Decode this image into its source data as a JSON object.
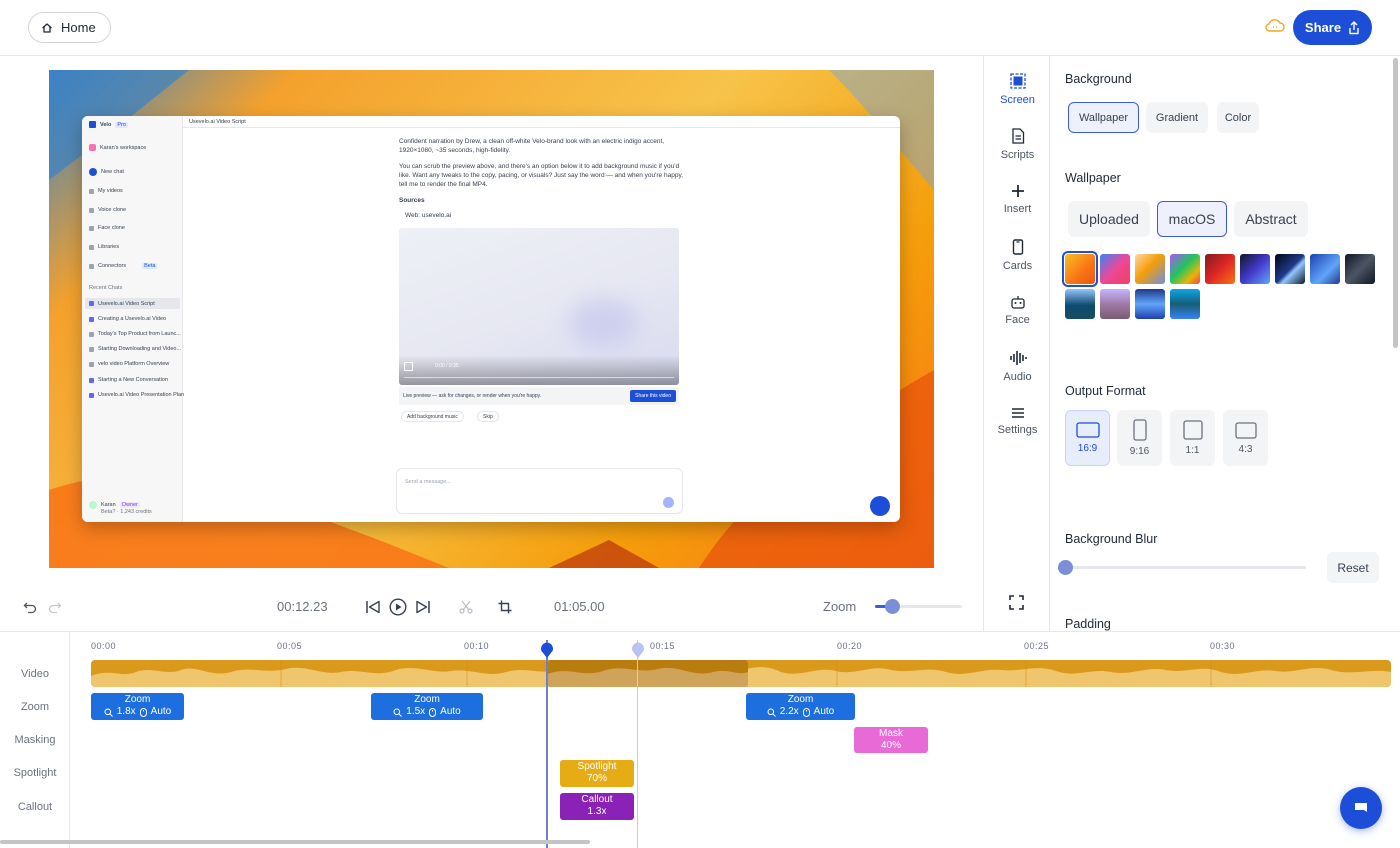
{
  "topbar": {
    "home_label": "Home",
    "share_label": "Share"
  },
  "preview": {
    "app": {
      "brand": "Velo",
      "brand_badge": "Pro",
      "workspace": "Karan's workspace",
      "nav": [
        "New chat",
        "My videos",
        "Voice clone",
        "Face clone",
        "Libraries",
        "Connectors"
      ],
      "connectors_badge": "Beta",
      "recent_title": "Recent Chats",
      "recent": [
        "Usevelo.ai Video Script",
        "Creating a Usevelo.ai Video",
        "Today's Top Product from Launc...",
        "Starting Downloading and Video...",
        "velo video Platform Overview",
        "Starting a New Conversation",
        "Usevelo.ai Video Presentation Plan"
      ],
      "user_name": "Karan",
      "user_badge": "Owner",
      "user_credits": "Beta? · 1,243 credits",
      "chat_title": "Usevelo.ai Video Script",
      "msg1": "Confident narration by Drew, a clean off-white Velo-brand look with an electric indigo accent, 1920×1080, ~35 seconds, high-fidelity.",
      "msg2": "You can scrub the preview above, and there's an option below it to add background music if you'd like. Want any tweaks to the copy, pacing, or visuals? Just say the word — and when you're happy, tell me to render the final MP4.",
      "sources_title": "Sources",
      "source_item": "Web: usevelo.ai",
      "video_time": "0:00 / 0:35",
      "live_text": "Live preview — ask for changes, or render when you're happy.",
      "share_video": "Share this video",
      "chip_music": "Add background music",
      "chip_skip": "Skip",
      "input_placeholder": "Send a message..."
    }
  },
  "transport": {
    "current_time": "00:12.23",
    "total_time": "01:05.00",
    "zoom_label": "Zoom",
    "zoom_level": 0.2
  },
  "rail": [
    {
      "label": "Screen",
      "icon": "screen-icon",
      "active": true
    },
    {
      "label": "Scripts",
      "icon": "document-icon"
    },
    {
      "label": "Insert",
      "icon": "plus-icon"
    },
    {
      "label": "Cards",
      "icon": "phone-card-icon"
    },
    {
      "label": "Face",
      "icon": "robot-face-icon"
    },
    {
      "label": "Audio",
      "icon": "waveform-icon"
    },
    {
      "label": "Settings",
      "icon": "menu-icon"
    }
  ],
  "panel": {
    "background_title": "Background",
    "background_tabs": [
      "Wallpaper",
      "Gradient",
      "Color"
    ],
    "background_selected": "Wallpaper",
    "wallpaper_title": "Wallpaper",
    "wallpaper_tabs": [
      "Uploaded",
      "macOS",
      "Abstract"
    ],
    "wallpaper_selected": "macOS",
    "wallpaper_selected_index": 0,
    "output_title": "Output Format",
    "formats": [
      "16:9",
      "9:16",
      "1:1",
      "4:3"
    ],
    "format_selected": "16:9",
    "blur_title": "Background Blur",
    "blur_value": 0,
    "reset_label": "Reset",
    "padding_title": "Padding"
  },
  "timeline": {
    "tracks": [
      "Video",
      "Zoom",
      "Masking",
      "Spotlight",
      "Callout"
    ],
    "ticks": [
      "00:00",
      "00:05",
      "00:10",
      "00:15",
      "00:20",
      "00:25",
      "00:30"
    ],
    "zooms": [
      {
        "title": "Zoom",
        "factor": "1.8x",
        "mode": "Auto"
      },
      {
        "title": "Zoom",
        "factor": "1.5x",
        "mode": "Auto"
      },
      {
        "title": "Zoom",
        "factor": "2.2x",
        "mode": "Auto"
      }
    ],
    "mask": {
      "title": "Mask",
      "value": "40%"
    },
    "spotlight": {
      "title": "Spotlight",
      "value": "70%"
    },
    "callout": {
      "title": "Callout",
      "value": "1.3x"
    }
  },
  "colors": {
    "accent": "#1d4ed8",
    "clip": "#d99a1c",
    "zoom": "#1d6fe0",
    "mask": "#e86ad6",
    "spotlight": "#e6ac16",
    "callout": "#8b22b8"
  }
}
